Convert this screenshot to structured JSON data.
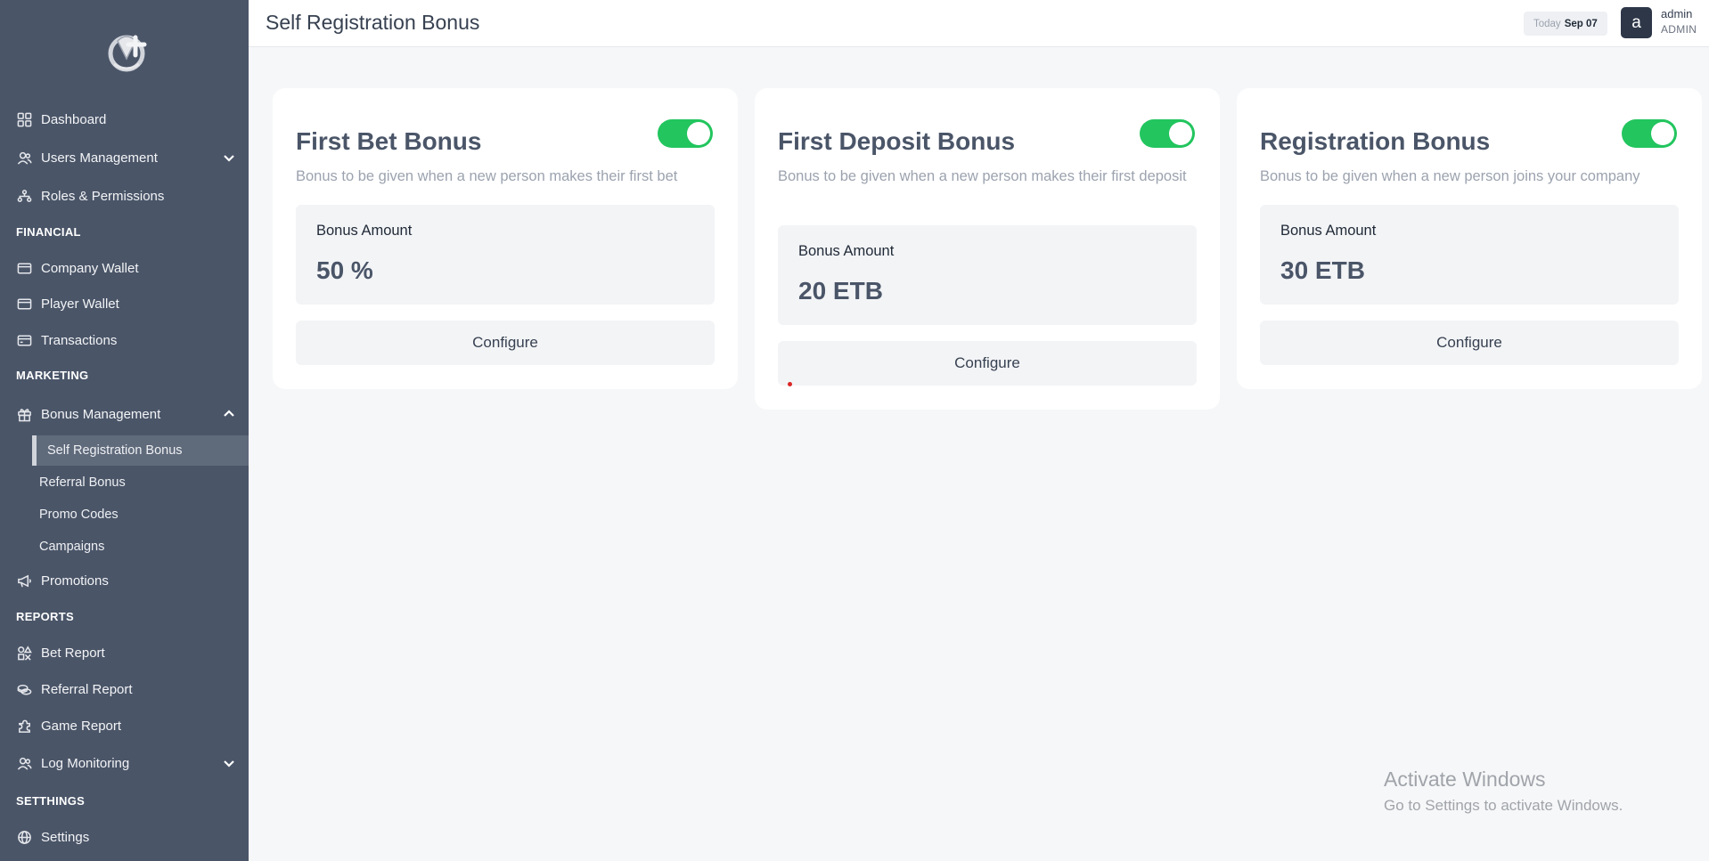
{
  "sidebar": {
    "items": {
      "dashboard": "Dashboard",
      "users_management": "Users Management",
      "roles_permissions": "Roles & Permissions",
      "company_wallet": "Company Wallet",
      "player_wallet": "Player Wallet",
      "transactions": "Transactions",
      "bonus_management": "Bonus Management",
      "promotions": "Promotions",
      "bet_report": "Bet Report",
      "referral_report": "Referral Report",
      "game_report": "Game Report",
      "log_monitoring": "Log Monitoring",
      "settings": "Settings"
    },
    "sections": {
      "financial": "FINANCIAL",
      "marketing": "MARKETING",
      "reports": "REPORTS",
      "settings": "SETTHINGS"
    },
    "bonus_sub": {
      "self_registration": "Self Registration Bonus",
      "referral": "Referral Bonus",
      "promo_codes": "Promo Codes",
      "campaigns": "Campaigns"
    }
  },
  "header": {
    "title": "Self Registration Bonus",
    "today_label": "Today",
    "today_date": "Sep 07",
    "avatar_letter": "a",
    "user_name": "admin",
    "user_role": "ADMIN"
  },
  "cards": [
    {
      "title": "First Bet Bonus",
      "description": "Bonus to be given when a new person makes their first bet",
      "enabled": true,
      "amount_label": "Bonus Amount",
      "amount_value": "50 %",
      "button": "Configure"
    },
    {
      "title": "First Deposit Bonus",
      "description": "Bonus to be given when a new person makes their first deposit",
      "enabled": true,
      "amount_label": "Bonus Amount",
      "amount_value": "20 ETB",
      "button": "Configure"
    },
    {
      "title": "Registration Bonus",
      "description": "Bonus to be given when a new person joins your company",
      "enabled": true,
      "amount_label": "Bonus Amount",
      "amount_value": "30 ETB",
      "button": "Configure"
    }
  ],
  "watermark": {
    "line1": "Activate Windows",
    "line2": "Go to Settings to activate Windows."
  },
  "colors": {
    "sidebar_bg": "#4a5568",
    "toggle_on": "#22c55e",
    "card_bg": "#ffffff",
    "page_bg": "#f6f7f8"
  }
}
